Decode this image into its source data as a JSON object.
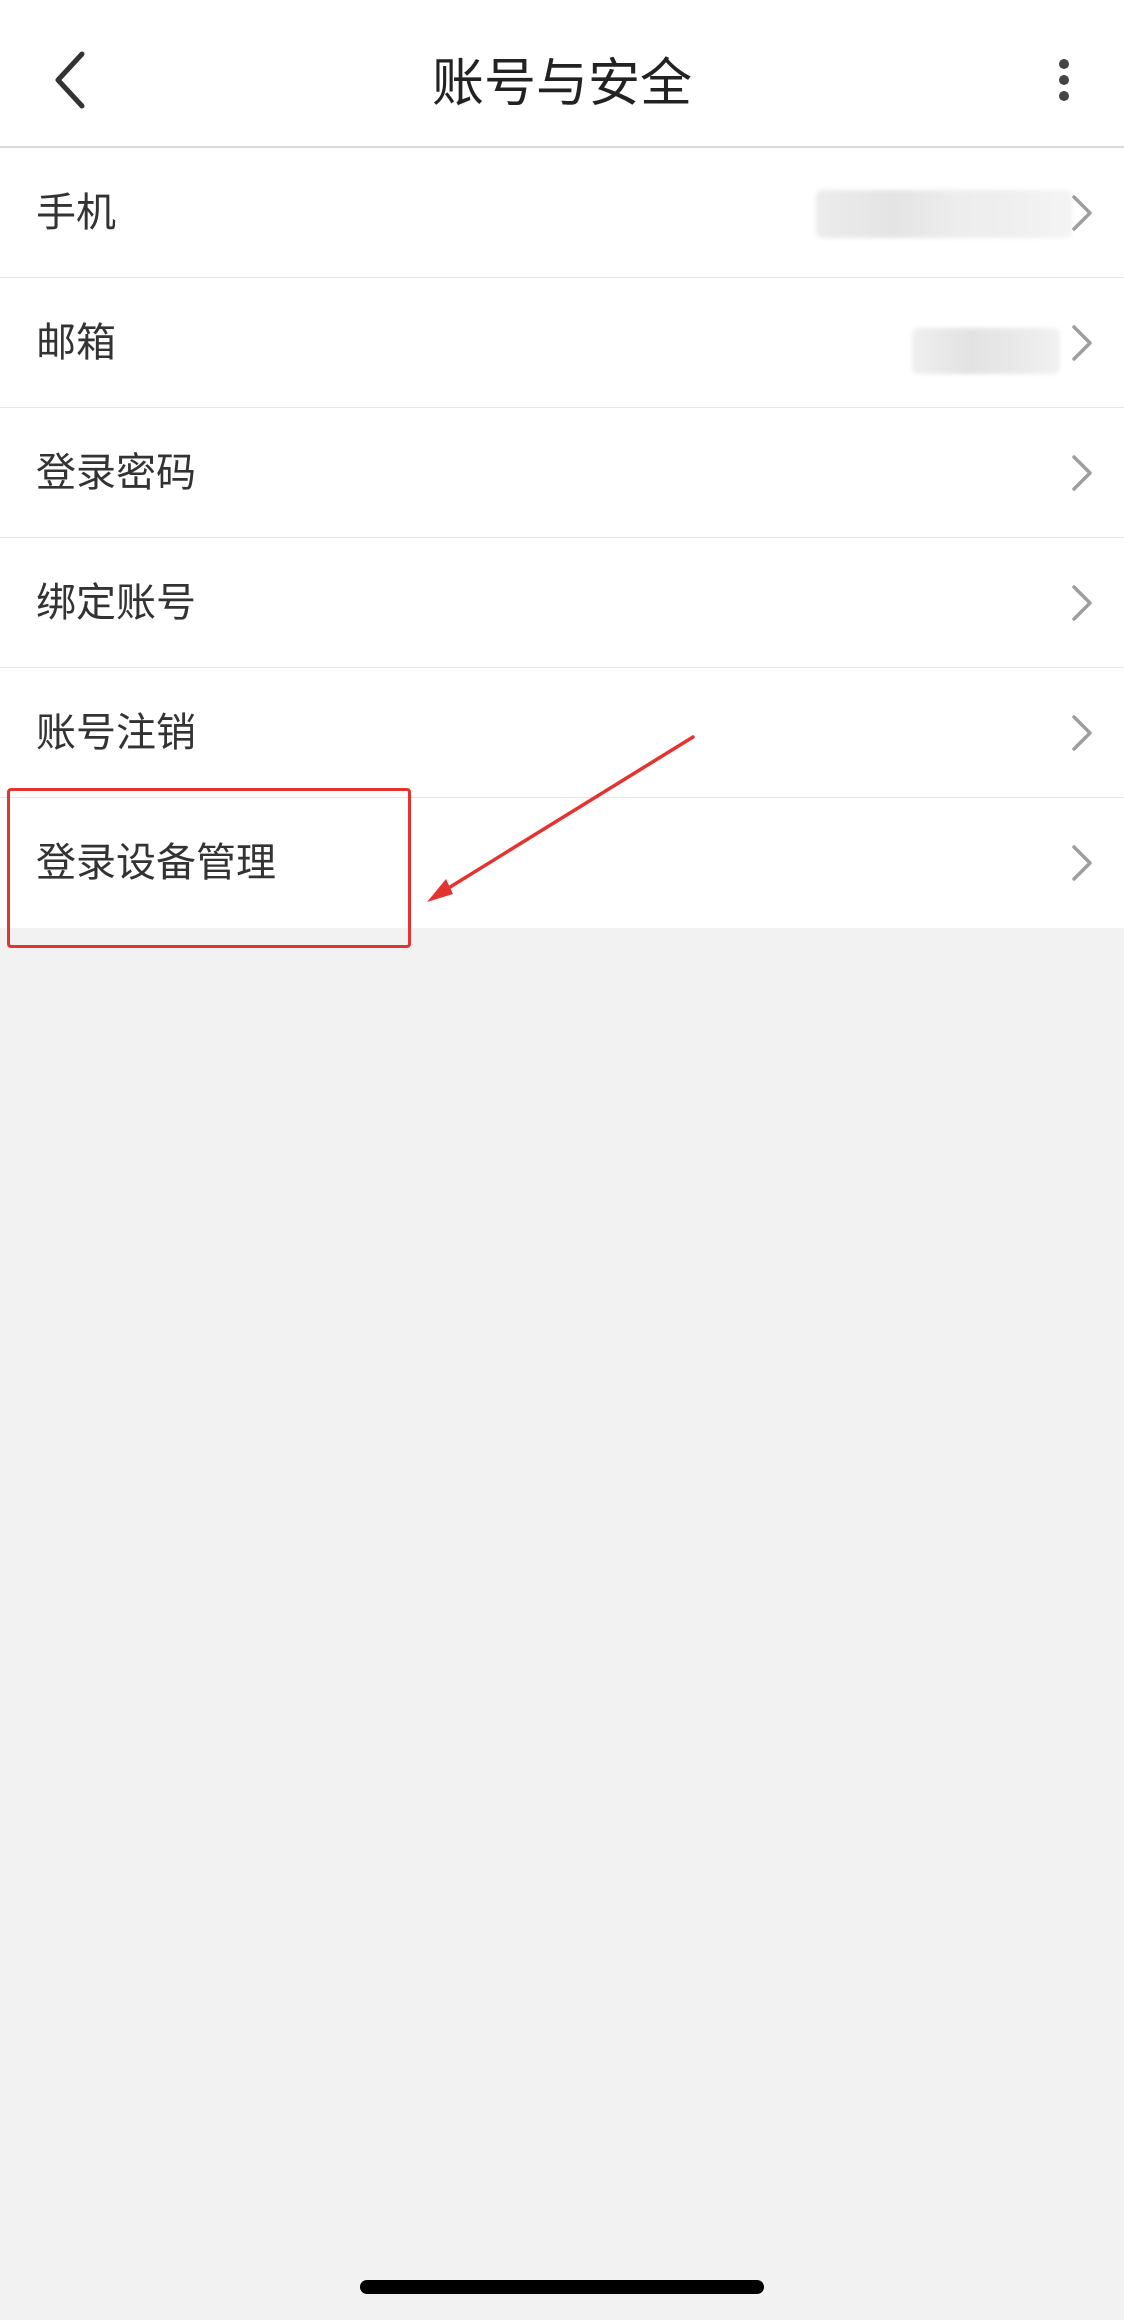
{
  "header": {
    "title": "账号与安全",
    "back_icon": "chevron-left-icon",
    "more_icon": "more-vertical-icon"
  },
  "settings": {
    "items": [
      {
        "label": "手机",
        "value_blurred": true
      },
      {
        "label": "邮箱",
        "value_blurred": true
      },
      {
        "label": "登录密码"
      },
      {
        "label": "绑定账号"
      },
      {
        "label": "账号注销"
      },
      {
        "label": "登录设备管理",
        "highlighted": true
      }
    ],
    "chevron_icon": "chevron-right-icon"
  },
  "colors": {
    "background": "#f2f2f2",
    "surface": "#ffffff",
    "text_primary": "#333333",
    "divider": "#e6e6e6",
    "annotation": "#e3342f",
    "chevron": "#9e9e9e"
  }
}
